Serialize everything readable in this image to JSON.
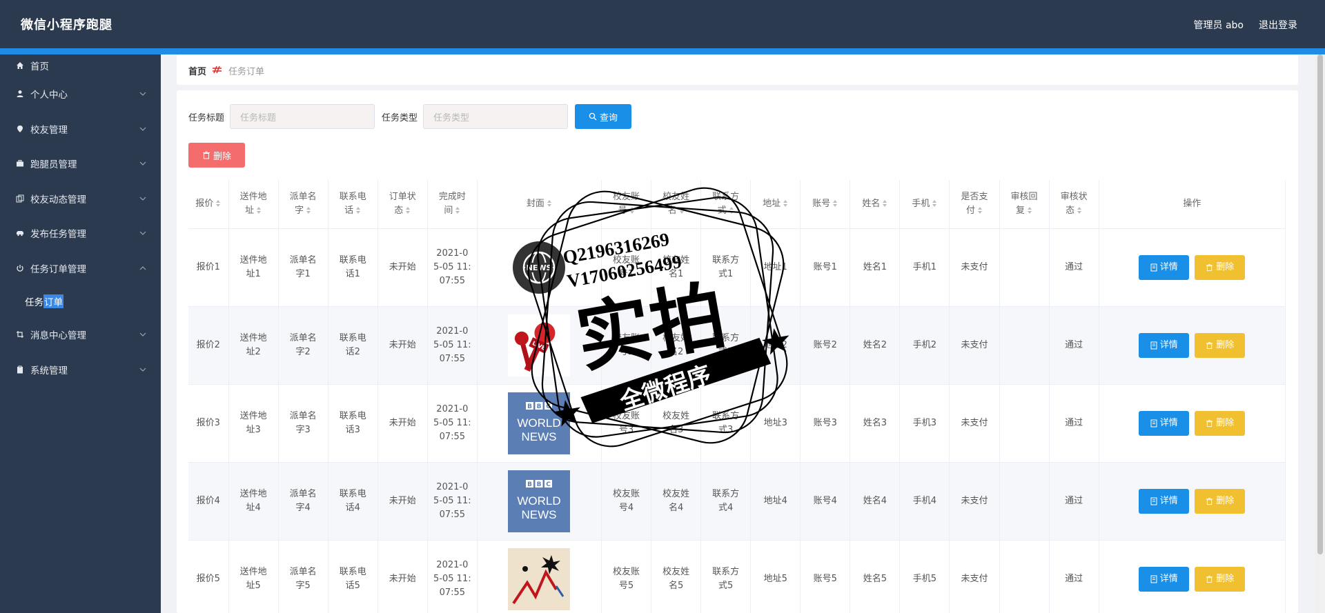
{
  "header": {
    "title": "微信小程序跑腿",
    "admin_label": "管理员 abo",
    "logout_label": "退出登录"
  },
  "sidebar": {
    "items": [
      {
        "label": "首页",
        "icon": "home-icon"
      },
      {
        "label": "个人中心",
        "icon": "user-icon"
      },
      {
        "label": "校友管理",
        "icon": "location-icon"
      },
      {
        "label": "跑腿员管理",
        "icon": "briefcase-icon"
      },
      {
        "label": "校友动态管理",
        "icon": "copy-icon"
      },
      {
        "label": "发布任务管理",
        "icon": "car-icon"
      },
      {
        "label": "任务订单管理",
        "icon": "power-icon"
      },
      {
        "label": "消息中心管理",
        "icon": "crop-icon"
      },
      {
        "label": "系统管理",
        "icon": "clipboard-icon"
      }
    ],
    "sub_item_prefix": "任务",
    "sub_item_highlight": "订单"
  },
  "breadcrumb": {
    "home": "首页",
    "current": "任务订单"
  },
  "search": {
    "title_label": "任务标题",
    "title_placeholder": "任务标题",
    "type_label": "任务类型",
    "type_placeholder": "任务类型",
    "query_label": "查询"
  },
  "actions": {
    "delete_label": "删除"
  },
  "table": {
    "headers": [
      "报价",
      "送件地址",
      "派单名字",
      "联系电话",
      "订单状态",
      "完成时间",
      "封面",
      "校友账号",
      "校友姓名",
      "联系方式",
      "地址",
      "账号",
      "姓名",
      "手机",
      "是否支付",
      "审核回复",
      "审核状态",
      "操作"
    ],
    "header_display": [
      "报价",
      "送件地\n址",
      "派单名\n字",
      "联系电\n话",
      "订单状\n态",
      "完成时\n间",
      "封面",
      "校友账\n号",
      "校友姓\n名",
      "联系方\n式",
      "地址",
      "账号",
      "姓名",
      "手机",
      "是否支\n付",
      "审核回\n复",
      "审核状\n态",
      "操作"
    ],
    "rows": [
      {
        "price": "报价1",
        "addr": "送件地\n址1",
        "name": "派单名\n字1",
        "phone": "联系电\n话1",
        "status": "未开始",
        "time": "2021-0\n5-05 11:\n07:55",
        "cover": "news-globe",
        "acc": "校友账\n号1",
        "aname": "校友姓\n名1",
        "contact": "联系方\n式1",
        "address": "地址1",
        "account": "账号1",
        "xm": "姓名1",
        "mobile": "手机1",
        "paid": "未支付",
        "reply": "",
        "audit": "通过"
      },
      {
        "price": "报价2",
        "addr": "送件地\n址2",
        "name": "派单名\n字2",
        "phone": "联系电\n话2",
        "status": "未开始",
        "time": "2021-0\n5-05 11:\n07:55",
        "cover": "live-mic",
        "acc": "校友账\n号2",
        "aname": "校友姓\n名2",
        "contact": "联系方\n式2",
        "address": "地址2",
        "account": "账号2",
        "xm": "姓名2",
        "mobile": "手机2",
        "paid": "未支付",
        "reply": "",
        "audit": "通过"
      },
      {
        "price": "报价3",
        "addr": "送件地\n址3",
        "name": "派单名\n字3",
        "phone": "联系电\n话3",
        "status": "未开始",
        "time": "2021-0\n5-05 11:\n07:55",
        "cover": "bbc",
        "acc": "校友账\n号3",
        "aname": "校友姓\n名3",
        "contact": "联系方\n式3",
        "address": "地址3",
        "account": "账号3",
        "xm": "姓名3",
        "mobile": "手机3",
        "paid": "未支付",
        "reply": "",
        "audit": "通过"
      },
      {
        "price": "报价4",
        "addr": "送件地\n址4",
        "name": "派单名\n字4",
        "phone": "联系电\n话4",
        "status": "未开始",
        "time": "2021-0\n5-05 11:\n07:55",
        "cover": "bbc",
        "acc": "校友账\n号4",
        "aname": "校友姓\n名4",
        "contact": "联系方\n式4",
        "address": "地址4",
        "account": "账号4",
        "xm": "姓名4",
        "mobile": "手机4",
        "paid": "未支付",
        "reply": "",
        "audit": "通过"
      },
      {
        "price": "报价5",
        "addr": "送件地\n址5",
        "name": "派单名\n字5",
        "phone": "联系电\n话5",
        "status": "未开始",
        "time": "2021-0\n5-05 11:\n07:55",
        "cover": "chart-art",
        "acc": "校友账\n号5",
        "aname": "校友姓\n名5",
        "contact": "联系方\n式5",
        "address": "地址5",
        "account": "账号5",
        "xm": "姓名5",
        "mobile": "手机5",
        "paid": "未支付",
        "reply": "",
        "audit": "通过"
      }
    ],
    "detail_label": "详情",
    "row_delete_label": "删除"
  },
  "watermark": {
    "line1": "Q2196316269",
    "line2": "V17060256499",
    "big": "实拍",
    "banner": "全微程序"
  },
  "colors": {
    "header_bg": "#2b3a4f",
    "accent": "#1f8de6",
    "primary_btn": "#1a8fe8",
    "danger_btn": "#f56c6c",
    "warning_btn": "#f0c030"
  }
}
